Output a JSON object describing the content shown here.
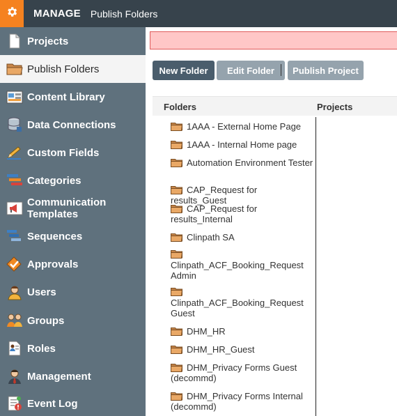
{
  "header": {
    "title": "MANAGE",
    "breadcrumb": "Publish Folders"
  },
  "sidebar": {
    "items": [
      {
        "label": "Projects",
        "icon": "document-icon"
      },
      {
        "label": "Publish Folders",
        "icon": "folder-icon",
        "active": true
      },
      {
        "label": "Content Library",
        "icon": "library-icon"
      },
      {
        "label": "Data Connections",
        "icon": "database-icon"
      },
      {
        "label": "Custom Fields",
        "icon": "pencil-icon"
      },
      {
        "label": "Categories",
        "icon": "categories-icon"
      },
      {
        "label": "Communication Templates",
        "icon": "megaphone-icon"
      },
      {
        "label": "Sequences",
        "icon": "sequences-icon"
      },
      {
        "label": "Approvals",
        "icon": "approvals-icon"
      },
      {
        "label": "Users",
        "icon": "user-icon"
      },
      {
        "label": "Groups",
        "icon": "groups-icon"
      },
      {
        "label": "Roles",
        "icon": "roles-icon"
      },
      {
        "label": "Management",
        "icon": "management-icon"
      },
      {
        "label": "Event Log",
        "icon": "event-log-icon"
      }
    ]
  },
  "toolbar": {
    "new_folder": "New Folder",
    "edit_folder": "Edit Folder",
    "publish_project": "Publish Project"
  },
  "table": {
    "headers": {
      "folders": "Folders",
      "projects": "Projects"
    },
    "folders": [
      {
        "name": "1AAA - External Home Page"
      },
      {
        "name": "1AAA - Internal Home page"
      },
      {
        "name": "Automation Environment Tester"
      },
      {
        "name": "CAP_Request for results_Guest"
      },
      {
        "name": "CAP_Request for results_Internal"
      },
      {
        "name": "Clinpath SA"
      },
      {
        "name": "Clinpath_ACF_Booking_Request Admin"
      },
      {
        "name": "Clinpath_ACF_Booking_Request Guest"
      },
      {
        "name": "DHM_HR"
      },
      {
        "name": "DHM_HR_Guest"
      },
      {
        "name": "DHM_Privacy Forms Guest (decommd)"
      },
      {
        "name": "DHM_Privacy Forms Internal (decommd)"
      }
    ]
  },
  "colors": {
    "topbar": "#37434c",
    "accent": "#f58220",
    "sidebar": "#5f717d",
    "primary_button": "#4a5d6c",
    "disabled_button": "#95a3ad",
    "alert_bg": "#ffc7c7",
    "alert_border": "#e05a5a"
  }
}
